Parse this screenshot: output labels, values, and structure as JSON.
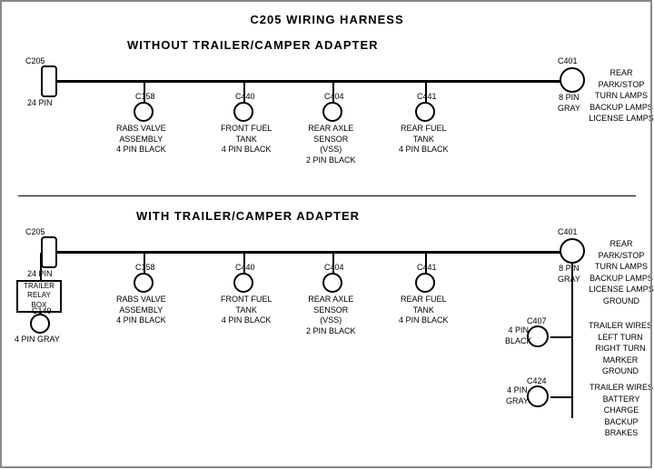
{
  "title": "C205 WIRING HARNESS",
  "section1": {
    "label": "WITHOUT  TRAILER/CAMPER  ADAPTER",
    "connectors": {
      "left": {
        "id": "C205",
        "pins": "24 PIN"
      },
      "right": {
        "id": "C401",
        "pins": "8 PIN",
        "color": "GRAY"
      }
    },
    "right_label": "REAR PARK/STOP\nTURN LAMPS\nBACKUP LAMPS\nLICENSE LAMPS",
    "nodes": [
      {
        "id": "C158",
        "desc": "RABS VALVE\nASSEMBLY\n4 PIN BLACK"
      },
      {
        "id": "C440",
        "desc": "FRONT FUEL\nTANK\n4 PIN BLACK"
      },
      {
        "id": "C404",
        "desc": "REAR AXLE\nSENSOR\n(VSS)\n2 PIN BLACK"
      },
      {
        "id": "C441",
        "desc": "REAR FUEL\nTANK\n4 PIN BLACK"
      }
    ]
  },
  "section2": {
    "label": "WITH  TRAILER/CAMPER  ADAPTER",
    "connectors": {
      "left": {
        "id": "C205",
        "pins": "24 PIN"
      },
      "right": {
        "id": "C401",
        "pins": "8 PIN",
        "color": "GRAY"
      }
    },
    "right_label": "REAR PARK/STOP\nTURN LAMPS\nBACKUP LAMPS\nLICENSE LAMPS\nGROUND",
    "extra_left": {
      "box": "TRAILER\nRELAY\nBOX",
      "connector": {
        "id": "C149",
        "desc": "4 PIN GRAY"
      }
    },
    "nodes": [
      {
        "id": "C158",
        "desc": "RABS VALVE\nASSEMBLY\n4 PIN BLACK"
      },
      {
        "id": "C440",
        "desc": "FRONT FUEL\nTANK\n4 PIN BLACK"
      },
      {
        "id": "C404",
        "desc": "REAR AXLE\nSENSOR\n(VSS)\n2 PIN BLACK"
      },
      {
        "id": "C441",
        "desc": "REAR FUEL\nTANK\n4 PIN BLACK"
      }
    ],
    "right_extra": [
      {
        "id": "C407",
        "desc": "4 PIN\nBLACK",
        "wires": "TRAILER WIRES\nLEFT TURN\nRIGHT TURN\nMARKER\nGROUND"
      },
      {
        "id": "C424",
        "desc": "4 PIN\nGRAY",
        "wires": "TRAILER WIRES\nBATTERY CHARGE\nBACKUP\nBRAKES"
      }
    ]
  }
}
